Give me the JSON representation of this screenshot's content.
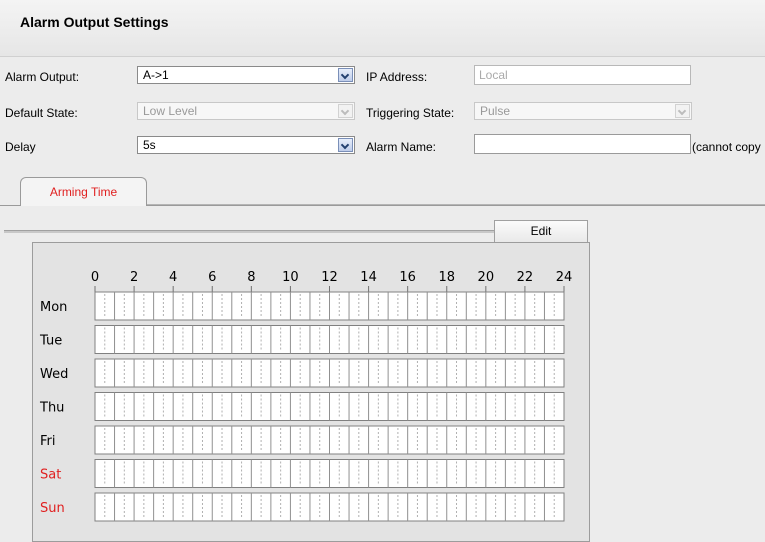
{
  "page": {
    "title": "Alarm Output Settings"
  },
  "form": {
    "alarm_output_label": "Alarm Output:",
    "alarm_output_value": "A->1",
    "ip_address_label": "IP Address:",
    "ip_address_placeholder": "Local",
    "default_state_label": "Default State:",
    "default_state_value": "Low Level",
    "triggering_state_label": "Triggering State:",
    "triggering_state_value": "Pulse",
    "delay_label": "Delay",
    "delay_value": "5s",
    "alarm_name_label": "Alarm Name:",
    "alarm_name_value": "",
    "alarm_name_note": "(cannot copy"
  },
  "tabs": [
    {
      "label": "Arming Time",
      "active": true
    }
  ],
  "toolbar": {
    "edit_label": "Edit"
  },
  "schedule": {
    "hour_labels": [
      "0",
      "2",
      "4",
      "6",
      "8",
      "10",
      "12",
      "14",
      "16",
      "18",
      "20",
      "22",
      "24"
    ],
    "days": [
      {
        "label": "Mon",
        "weekend": false
      },
      {
        "label": "Tue",
        "weekend": false
      },
      {
        "label": "Wed",
        "weekend": false
      },
      {
        "label": "Thu",
        "weekend": false
      },
      {
        "label": "Fri",
        "weekend": false
      },
      {
        "label": "Sat",
        "weekend": true
      },
      {
        "label": "Sun",
        "weekend": true
      }
    ],
    "colors": {
      "weekday": "#000000",
      "weekend": "#e02020",
      "grid": "#808080",
      "cell_bg": "#ffffff"
    }
  },
  "colors": {
    "accent": "#e02020",
    "background": "#ececec"
  }
}
